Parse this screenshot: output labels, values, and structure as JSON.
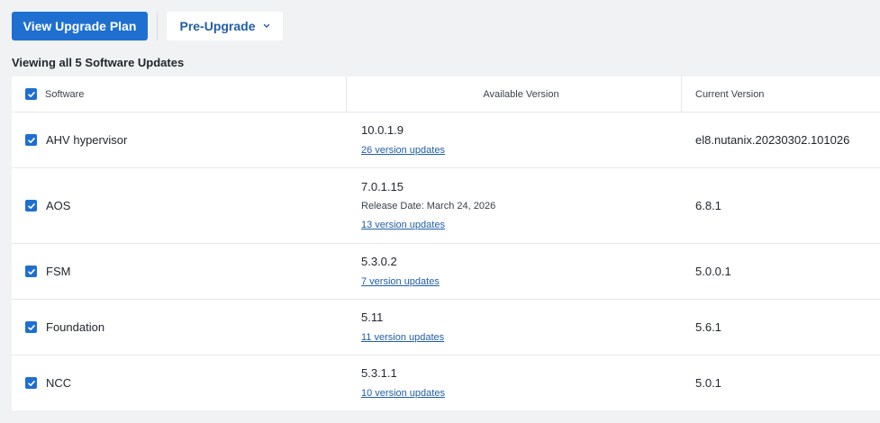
{
  "toolbar": {
    "view_upgrade_plan": "View Upgrade Plan",
    "pre_upgrade": "Pre-Upgrade"
  },
  "heading": "Viewing all 5 Software Updates",
  "table": {
    "columns": [
      "Software",
      "Available Version",
      "Current Version"
    ],
    "rows": [
      {
        "software": "AHV hypervisor",
        "available": "10.0.1.9",
        "release_date": "",
        "updates": "26 version updates",
        "current": "el8.nutanix.20230302.101026"
      },
      {
        "software": "AOS",
        "available": "7.0.1.15",
        "release_date": "Release Date: March 24, 2026",
        "updates": "13 version updates",
        "current": "6.8.1"
      },
      {
        "software": "FSM",
        "available": "5.3.0.2",
        "release_date": "",
        "updates": "7 version updates",
        "current": "5.0.0.1"
      },
      {
        "software": "Foundation",
        "available": "5.11",
        "release_date": "",
        "updates": "11 version updates",
        "current": "5.6.1"
      },
      {
        "software": "NCC",
        "available": "5.3.1.1",
        "release_date": "",
        "updates": "10 version updates",
        "current": "5.0.1"
      }
    ]
  },
  "colors": {
    "primary": "#1f6fd1",
    "link": "#1f5ea8",
    "background": "#f1f2f4"
  },
  "icons": {
    "checkbox": "check-icon",
    "dropdown": "chevron-down-icon"
  }
}
